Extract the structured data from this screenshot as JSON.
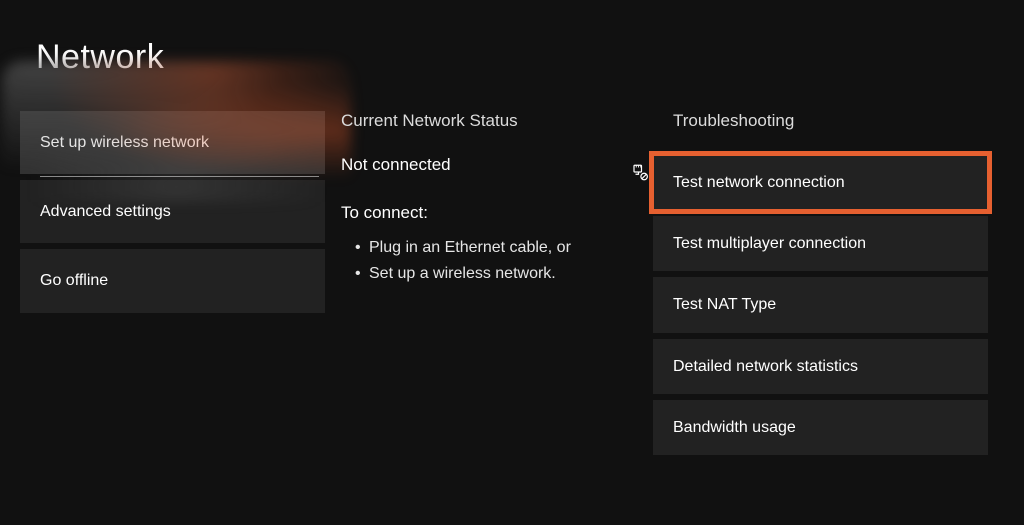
{
  "title": "Network",
  "highlight_color": "#e66030",
  "left": {
    "setup_label": "Set up wireless network",
    "advanced_label": "Advanced settings",
    "offline_label": "Go offline"
  },
  "status": {
    "heading": "Current Network Status",
    "value": "Not connected",
    "connect_heading": "To connect:",
    "bullets": [
      "Plug in an Ethernet cable, or",
      "Set up a wireless network."
    ],
    "icon_name": "ethernet-disconnected-icon"
  },
  "troubleshooting": {
    "heading": "Troubleshooting",
    "items": [
      {
        "label": "Test network connection",
        "selected": true
      },
      {
        "label": "Test multiplayer connection",
        "selected": false
      },
      {
        "label": "Test NAT Type",
        "selected": false
      },
      {
        "label": "Detailed network statistics",
        "selected": false
      },
      {
        "label": "Bandwidth usage",
        "selected": false
      }
    ]
  }
}
